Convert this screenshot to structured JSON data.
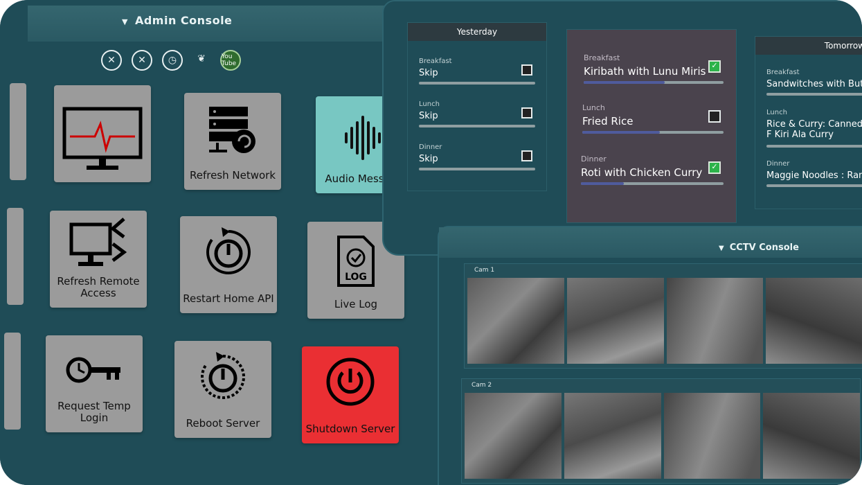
{
  "admin": {
    "title": "Admin Console",
    "status_icons": [
      "bluetooth-off-icon",
      "bluetooth-off-icon",
      "alarm-icon",
      "wheat-icon",
      "youtube-icon"
    ],
    "youtube_label": "You Tube",
    "tiles": [
      {
        "label": "",
        "icon": "monitor-pulse-icon"
      },
      {
        "label": "Refresh Network",
        "icon": "server-refresh-icon"
      },
      {
        "label": "Audio Message",
        "icon": "soundwave-icon"
      },
      {
        "label": "Refresh Remote Access",
        "icon": "remote-monitor-icon"
      },
      {
        "label": "Restart Home API",
        "icon": "power-restart-icon"
      },
      {
        "label": "Live Log",
        "icon": "log-file-icon"
      },
      {
        "label": "Request Temp Login",
        "icon": "clock-key-icon"
      },
      {
        "label": "Reboot Server",
        "icon": "power-restart-icon"
      },
      {
        "label": "Shutdown Server",
        "icon": "power-icon"
      }
    ]
  },
  "meals": {
    "yesterday": {
      "title": "Yesterday",
      "items": [
        {
          "category": "Breakfast",
          "name": "Skip",
          "checked": false,
          "progress": 0
        },
        {
          "category": "Lunch",
          "name": "Skip",
          "checked": false,
          "progress": 0
        },
        {
          "category": "Dinner",
          "name": "Skip",
          "checked": false,
          "progress": 0
        }
      ]
    },
    "today": {
      "items": [
        {
          "category": "Breakfast",
          "name": "Kiribath with Lunu Miris",
          "checked": true,
          "progress": 0.58
        },
        {
          "category": "Lunch",
          "name": "Fried Rice",
          "checked": false,
          "progress": 0.55
        },
        {
          "category": "Dinner",
          "name": "Roti with Chicken Curry",
          "checked": true,
          "progress": 0.3
        }
      ]
    },
    "tomorrow": {
      "title": "Tomorrow",
      "items": [
        {
          "category": "Breakfast",
          "name": "Sandwitches with Butte",
          "progress": 0
        },
        {
          "category": "Lunch",
          "name": "Rice & Curry: Canned F Kiri Ala Curry",
          "progress": 0
        },
        {
          "category": "Dinner",
          "name": "Maggie Noodles : Ramo",
          "progress": 0
        }
      ]
    }
  },
  "cctv": {
    "title": "CCTV Console",
    "cams": [
      {
        "label": "Cam 1",
        "feeds": 4
      },
      {
        "label": "Cam 2",
        "feeds": 4
      }
    ]
  }
}
